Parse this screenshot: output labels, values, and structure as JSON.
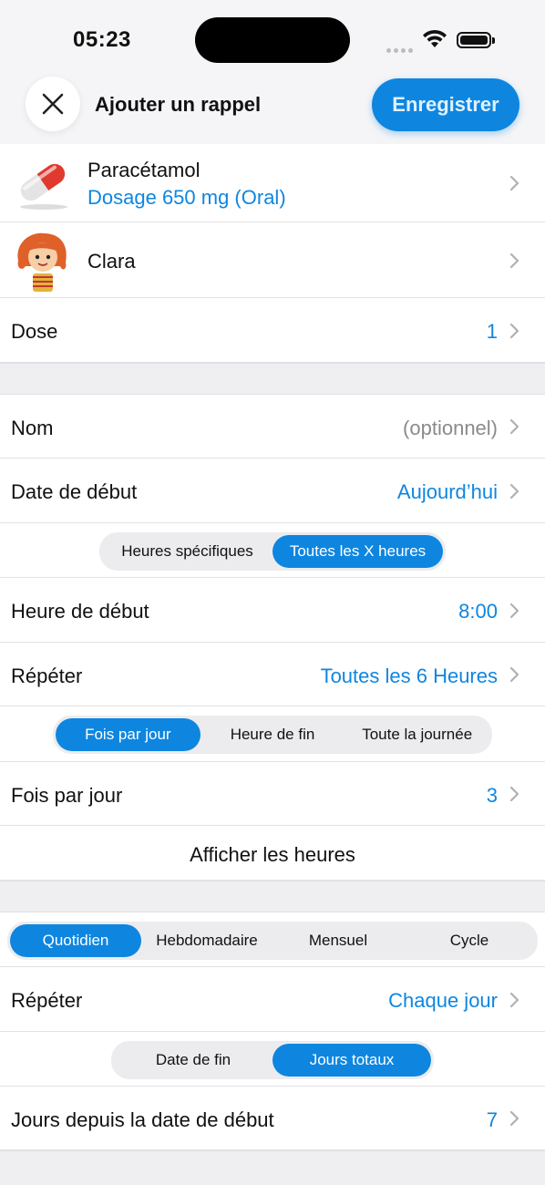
{
  "status": {
    "time": "05:23"
  },
  "header": {
    "title": "Ajouter un rappel",
    "save_label": "Enregistrer"
  },
  "medication": {
    "name": "Paracétamol",
    "dosage": "Dosage 650 mg (Oral)"
  },
  "person": {
    "name": "Clara"
  },
  "dose": {
    "label": "Dose",
    "value": "1"
  },
  "name_row": {
    "label": "Nom",
    "placeholder": "(optionnel)"
  },
  "start_date": {
    "label": "Date de début",
    "value": "Aujourd’hui"
  },
  "schedule_mode": {
    "options": [
      "Heures spécifiques",
      "Toutes les X heures"
    ],
    "selected": 1
  },
  "start_time": {
    "label": "Heure de début",
    "value": "8:00"
  },
  "repeat_hours": {
    "label": "Répéter",
    "value": "Toutes les 6 Heures"
  },
  "limit_mode": {
    "options": [
      "Fois par jour",
      "Heure de fin",
      "Toute la journée"
    ],
    "selected": 0
  },
  "times_per_day": {
    "label": "Fois par jour",
    "value": "3"
  },
  "show_times": {
    "label": "Afficher les heures"
  },
  "frequency": {
    "options": [
      "Quotidien",
      "Hebdomadaire",
      "Mensuel",
      "Cycle"
    ],
    "selected": 0
  },
  "repeat_days": {
    "label": "Répéter",
    "value": "Chaque jour"
  },
  "end_mode": {
    "options": [
      "Date de fin",
      "Jours totaux"
    ],
    "selected": 1
  },
  "days_since": {
    "label": "Jours depuis la date de début",
    "value": "7"
  },
  "colors": {
    "accent": "#0e86e0",
    "background": "#efeff1"
  }
}
